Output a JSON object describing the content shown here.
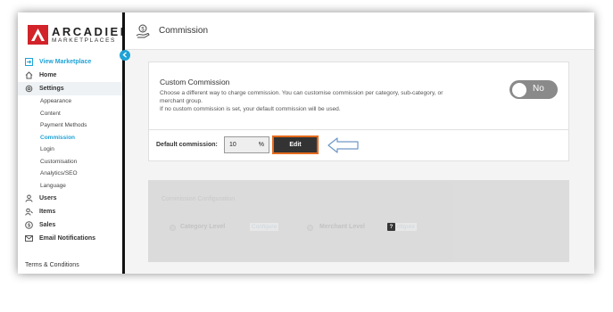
{
  "brand": {
    "title": "ARCADIER",
    "subtitle": "MARKETPLACES",
    "accent": "#d2232a"
  },
  "sidebar": {
    "view_marketplace": "View Marketplace",
    "home": "Home",
    "settings": "Settings",
    "settings_items": [
      "Appearance",
      "Content",
      "Payment Methods",
      "Commission",
      "Login",
      "Customisation",
      "Analytics/SEO",
      "Language"
    ],
    "users": "Users",
    "items": "Items",
    "sales": "Sales",
    "email_notifications": "Email Notifications",
    "terms": "Terms & Conditions"
  },
  "header": {
    "title": "Commission"
  },
  "custom_commission": {
    "title": "Custom Commission",
    "description": "Choose a different way to charge commission. You can customise commission per category, sub-category, or merchant group.",
    "note": "If no custom commission is set, your default commission will be used.",
    "toggle_label": "No"
  },
  "default_commission": {
    "label": "Default commission:",
    "value": "10",
    "unit": "%",
    "edit_label": "Edit"
  },
  "config": {
    "title": "Commission Configuration",
    "category_level": "Category Level",
    "merchant_level": "Merchant Level",
    "configure": "Configure",
    "merchant_configure": "nfigure",
    "help_icon": "?"
  },
  "colors": {
    "link": "#1fa3d6",
    "edit_border": "#e46a1c",
    "toggle_off": "#8a8a8a"
  }
}
